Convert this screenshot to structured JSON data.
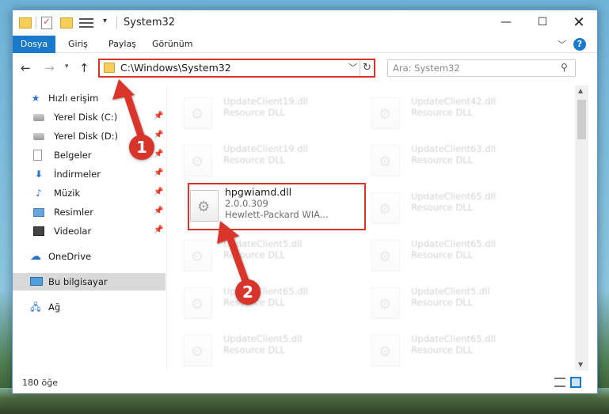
{
  "window": {
    "title": "System32",
    "buttons": {
      "minimize": "—",
      "maximize": "☐",
      "close": "✕"
    }
  },
  "ribbon": {
    "tabs": [
      "Dosya",
      "Giriş",
      "Paylaş",
      "Görünüm"
    ],
    "help": "?"
  },
  "navigation": {
    "address": "C:\\Windows\\System32",
    "search_placeholder": "Ara: System32"
  },
  "sidebar": {
    "items": [
      {
        "label": "Hızlı erişim",
        "icon": "star-icon"
      },
      {
        "label": "Yerel Disk (C:)",
        "icon": "drive-icon",
        "pinned": true
      },
      {
        "label": "Yerel Disk (D:)",
        "icon": "drive-icon",
        "pinned": true
      },
      {
        "label": "Belgeler",
        "icon": "document-icon",
        "pinned": true
      },
      {
        "label": "İndirmeler",
        "icon": "download-icon",
        "pinned": true
      },
      {
        "label": "Müzik",
        "icon": "music-icon",
        "pinned": true
      },
      {
        "label": "Resimler",
        "icon": "pictures-icon",
        "pinned": true
      },
      {
        "label": "Videolar",
        "icon": "video-icon",
        "pinned": true
      },
      {
        "label": "OneDrive",
        "icon": "cloud-icon"
      },
      {
        "label": "Bu bilgisayar",
        "icon": "computer-icon",
        "selected": true
      },
      {
        "label": "Ağ",
        "icon": "network-icon"
      }
    ]
  },
  "files": {
    "left_column": [
      {
        "name": "UpdateClient19.dll",
        "type": "Resource DLL"
      },
      {
        "name": "UpdateClient19.dll",
        "type": "Resource DLL"
      },
      {
        "name": "UpdateClient5.dll",
        "type": "Resource DLL"
      },
      {
        "name": "UpdateClient65.dll",
        "type": "Resource DLL"
      },
      {
        "name": "UpdateClient5.dll",
        "type": "Resource DLL"
      }
    ],
    "right_column": [
      {
        "name": "UpdateClient42.dll",
        "type": "Resource DLL"
      },
      {
        "name": "UpdateClient63.dll",
        "type": "Resource DLL"
      },
      {
        "name": "UpdateClient65.dll",
        "type": "Resource DLL"
      },
      {
        "name": "UpdateClient65.dll",
        "type": "Resource DLL"
      },
      {
        "name": "UpdateClient5.dll",
        "type": "Resource DLL"
      },
      {
        "name": "UpdateClient65.dll",
        "type": "Resource DLL"
      }
    ],
    "highlighted": {
      "name": "hpgwiamd.dll",
      "version": "2.0.0.309",
      "company": "Hewlett-Packard WIA..."
    }
  },
  "status": {
    "count": "180 öğe"
  },
  "annotations": {
    "marker1": "1",
    "marker2": "2",
    "color": "#d9342b"
  }
}
